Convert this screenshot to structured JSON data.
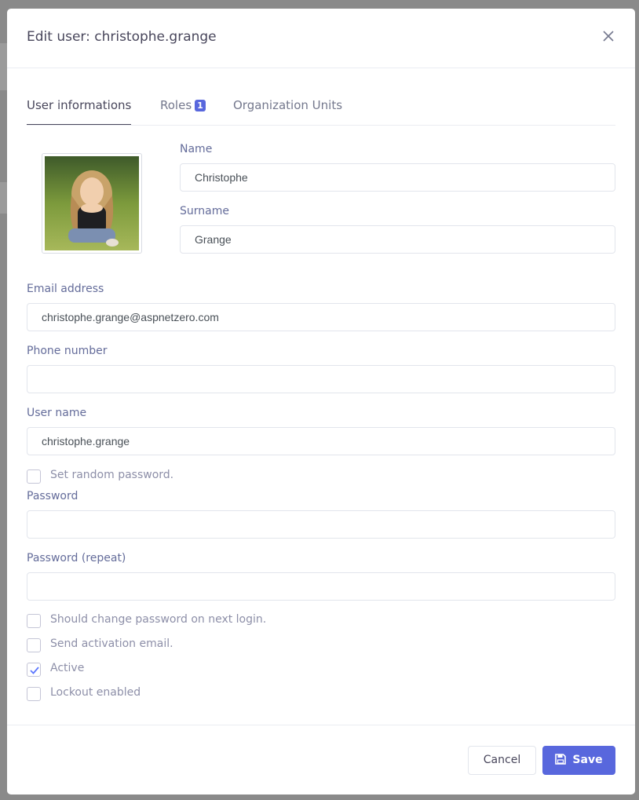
{
  "modal": {
    "title": "Edit user: christophe.grange",
    "close_icon": "close-icon"
  },
  "tabs": [
    {
      "label": "User informations",
      "active": true
    },
    {
      "label": "Roles",
      "badge": "1",
      "active": false
    },
    {
      "label": "Organization Units",
      "active": false
    }
  ],
  "form": {
    "name": {
      "label": "Name",
      "value": "Christophe"
    },
    "surname": {
      "label": "Surname",
      "value": "Grange"
    },
    "email": {
      "label": "Email address",
      "value": "christophe.grange@aspnetzero.com"
    },
    "phone": {
      "label": "Phone number",
      "value": ""
    },
    "username": {
      "label": "User name",
      "value": "christophe.grange"
    },
    "password": {
      "label": "Password",
      "value": ""
    },
    "password_repeat": {
      "label": "Password (repeat)",
      "value": ""
    }
  },
  "checkboxes": [
    {
      "label": "Set random password.",
      "checked": false
    },
    {
      "label": "Should change password on next login.",
      "checked": false
    },
    {
      "label": "Send activation email.",
      "checked": false
    },
    {
      "label": "Active",
      "checked": true
    },
    {
      "label": "Lockout enabled",
      "checked": false
    }
  ],
  "footer": {
    "cancel_label": "Cancel",
    "save_label": "Save",
    "save_icon": "floppy-disk-icon"
  },
  "colors": {
    "primary": "#5867dd",
    "text": "#48465b",
    "muted": "#74788d",
    "border": "#e2e5ec"
  }
}
